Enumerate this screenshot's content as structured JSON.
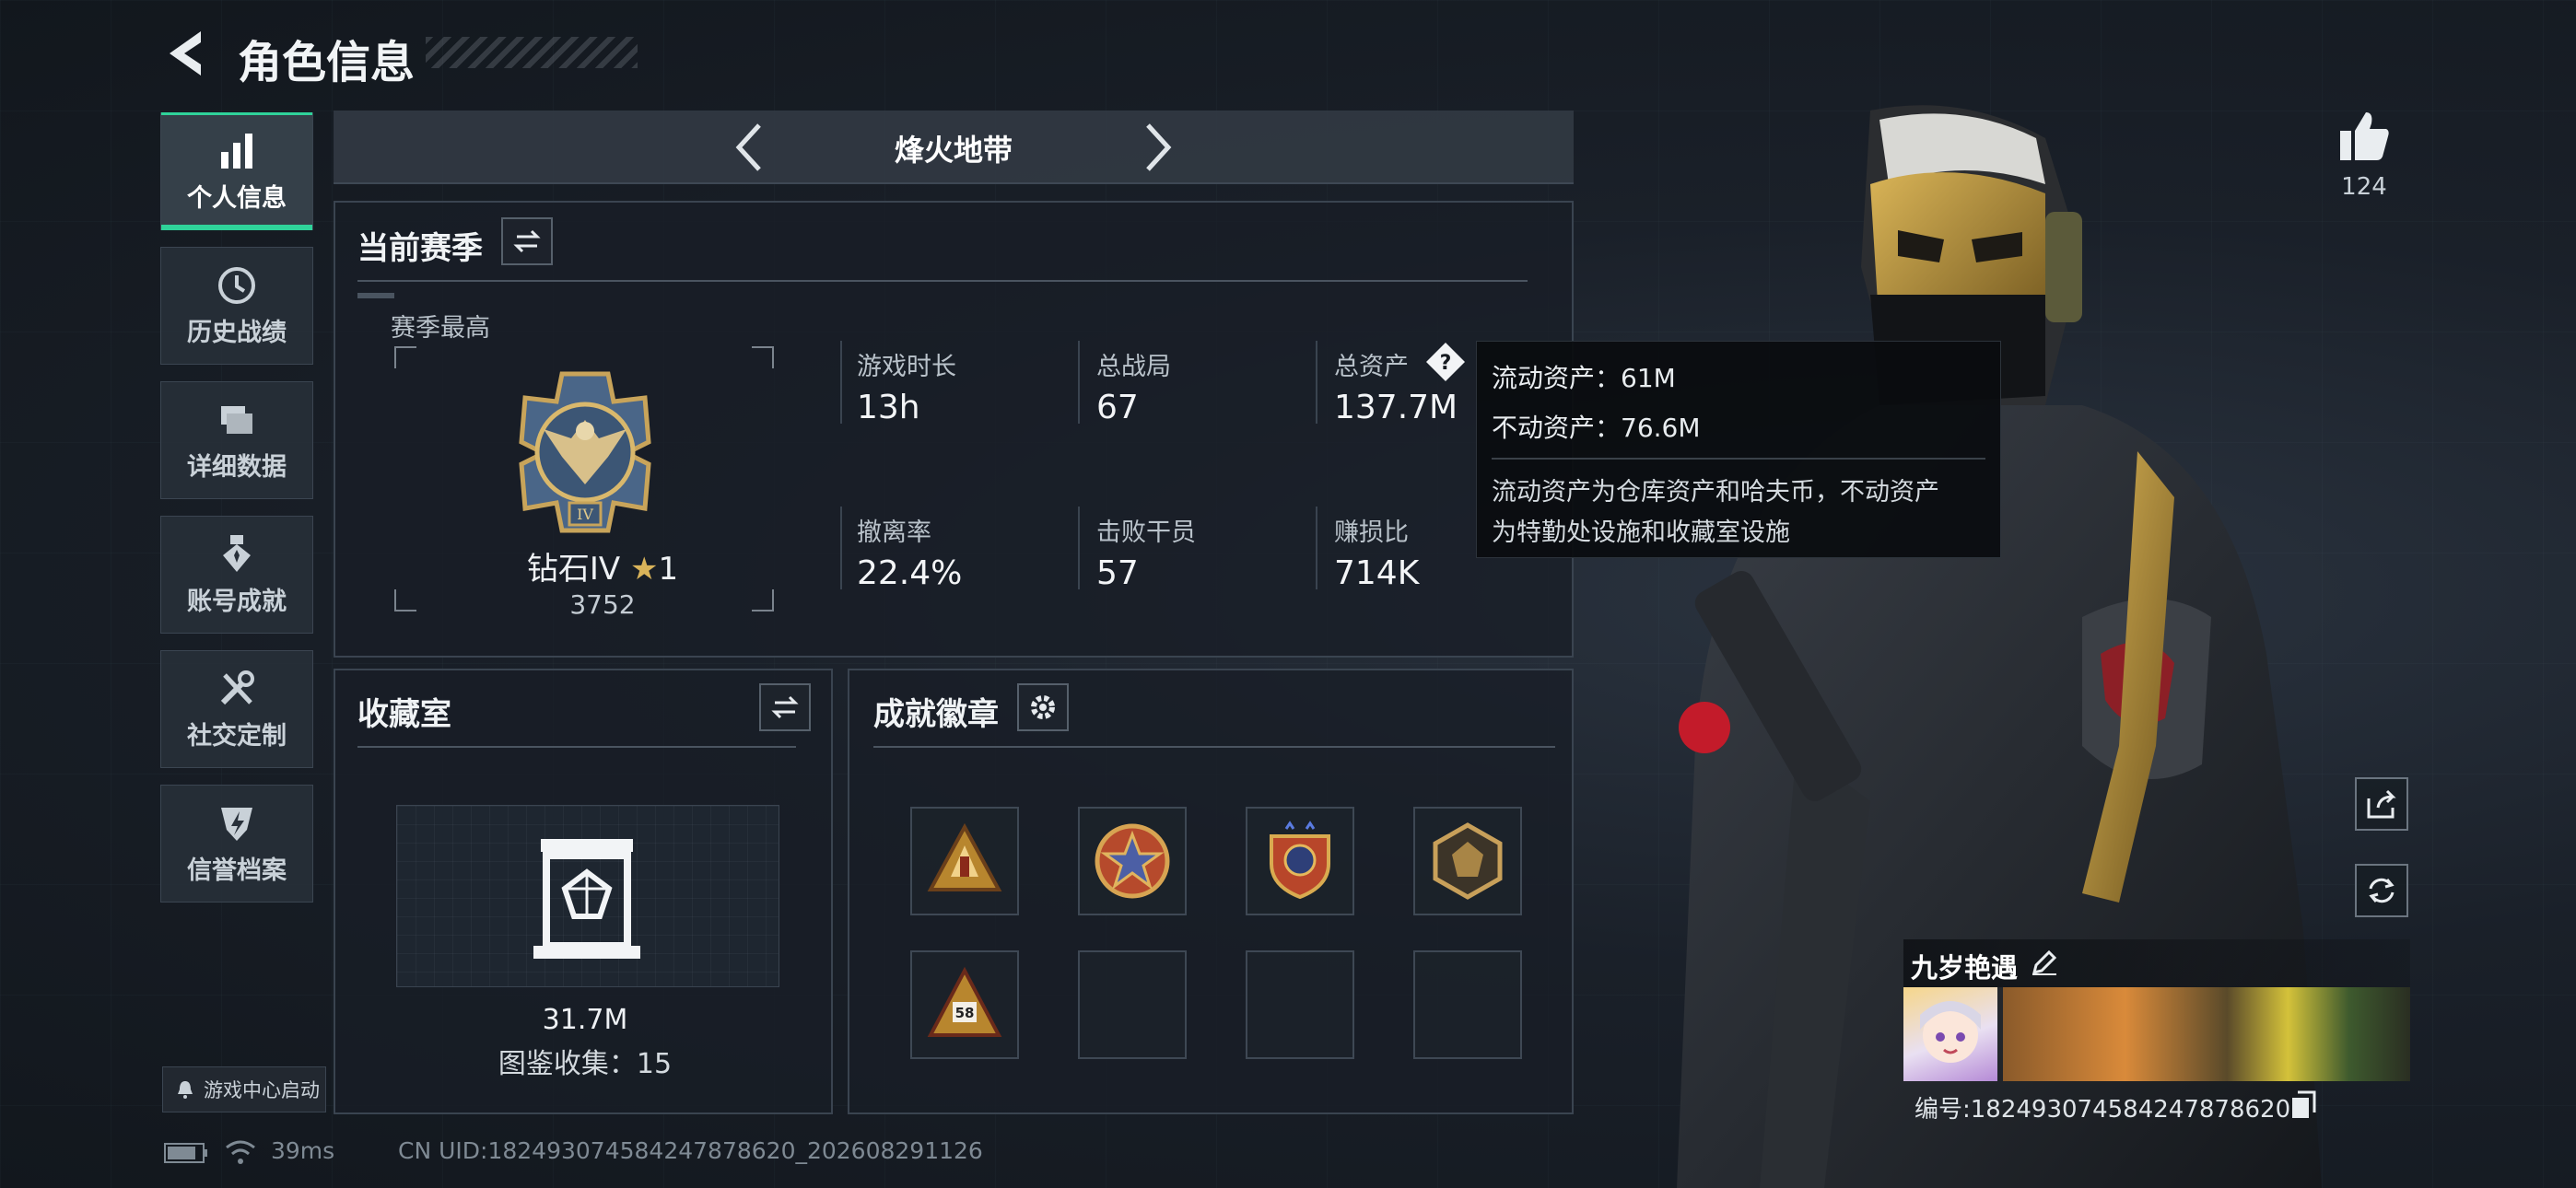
{
  "header": {
    "title": "角色信息"
  },
  "sidebar": {
    "items": [
      {
        "label": "个人信息",
        "icon": "bar-chart-icon",
        "active": true
      },
      {
        "label": "历史战绩",
        "icon": "history-clock-icon"
      },
      {
        "label": "详细数据",
        "icon": "folders-icon"
      },
      {
        "label": "账号成就",
        "icon": "medal-icon"
      },
      {
        "label": "社交定制",
        "icon": "tools-icon"
      },
      {
        "label": "信誉档案",
        "icon": "shield-bolt-icon"
      }
    ],
    "launch_label": "游戏中心启动"
  },
  "mode": {
    "title": "烽火地带"
  },
  "season": {
    "title": "当前赛季",
    "best_label": "赛季最高",
    "rank_name": "钻石IV",
    "rank_stars": "1",
    "rank_score": "3752",
    "stats": [
      {
        "label": "游戏时长",
        "value": "13h"
      },
      {
        "label": "总战局",
        "value": "67"
      },
      {
        "label": "总资产",
        "value": "137.7M"
      },
      {
        "label": "撤离率",
        "value": "22.4%"
      },
      {
        "label": "击败干员",
        "value": "57"
      },
      {
        "label": "赚损比",
        "value": "714K"
      }
    ]
  },
  "tooltip": {
    "liquid": "流动资产：61M",
    "fixed": "不动资产：76.6M",
    "desc1": "流动资产为仓库资产和哈夫币，不动资产",
    "desc2": "为特勤处设施和收藏室设施"
  },
  "collection": {
    "title": "收藏室",
    "value": "31.7M",
    "count_text": "图鉴收集：15"
  },
  "achievements": {
    "title": "成就徽章",
    "badges": [
      "triangle-badge",
      "star-round-badge",
      "shield-star-badge",
      "hex-lion-badge",
      "triangle-58-badge",
      "",
      "",
      ""
    ],
    "badge_58_text": "58"
  },
  "profile": {
    "likes": "124",
    "name": "九岁艳遇",
    "id_text": "编号:182493074584247878620"
  },
  "status": {
    "ping": "39ms",
    "uid": "CN UID:182493074584247878620_202608291126"
  },
  "colors": {
    "accent": "#2fd39a",
    "gold": "#c9a24a",
    "panel_border": "#3a4450"
  }
}
